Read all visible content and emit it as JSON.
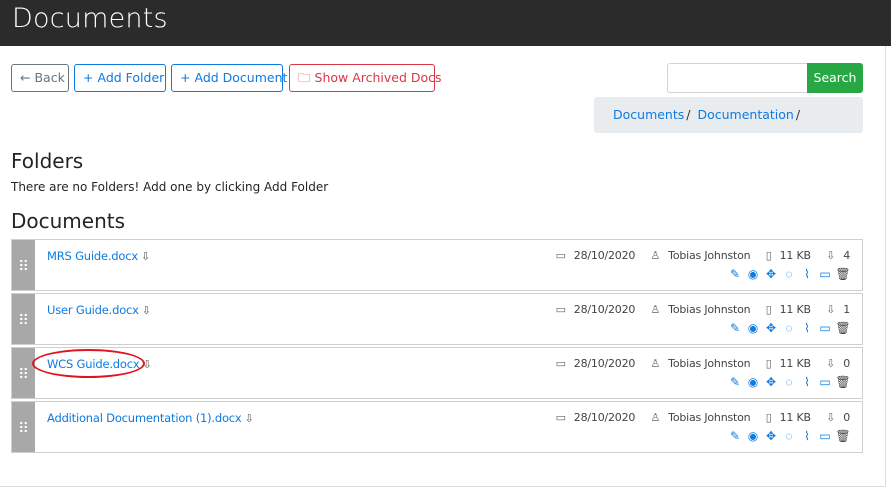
{
  "header": {
    "title": "Documents"
  },
  "toolbar": {
    "back_label": "Back",
    "add_folder_label": "Add Folder",
    "add_document_label": "Add Document",
    "show_archived_label": "Show Archived Docs"
  },
  "search": {
    "value": "",
    "placeholder": "",
    "button_label": "Search"
  },
  "breadcrumb": {
    "items": [
      "Documents",
      "Documentation"
    ],
    "separator": "/"
  },
  "folders": {
    "heading": "Folders",
    "empty_message": "There are no Folders! Add one by clicking Add Folder"
  },
  "documents": {
    "heading": "Documents",
    "items": [
      {
        "name": "MRS Guide.docx",
        "date": "28/10/2020",
        "author": "Tobias Johnston",
        "size": "11 KB",
        "downloads": "4"
      },
      {
        "name": "User Guide.docx",
        "date": "28/10/2020",
        "author": "Tobias Johnston",
        "size": "11 KB",
        "downloads": "1"
      },
      {
        "name": "WCS Guide.docx",
        "date": "28/10/2020",
        "author": "Tobias Johnston",
        "size": "11 KB",
        "downloads": "0"
      },
      {
        "name": "Additional Documentation (1).docx",
        "date": "28/10/2020",
        "author": "Tobias Johnston",
        "size": "11 KB",
        "downloads": "0"
      }
    ]
  },
  "icons": {
    "back": "arrow-left-icon",
    "add": "plus-icon",
    "archive": "folder-icon",
    "download": "download-icon",
    "calendar": "calendar-icon",
    "user": "user-icon",
    "file": "file-icon",
    "edit": "pencil-icon",
    "view": "eye-icon",
    "move": "move-icon",
    "comment": "comment-icon",
    "attach": "paperclip-icon",
    "folder": "folder-icon",
    "delete": "trash-icon"
  },
  "colors": {
    "primary": "#0d7be0",
    "danger": "#dc3545",
    "success": "#28a745",
    "header_bg": "#2b2b2b",
    "highlight": "#e0141e"
  }
}
